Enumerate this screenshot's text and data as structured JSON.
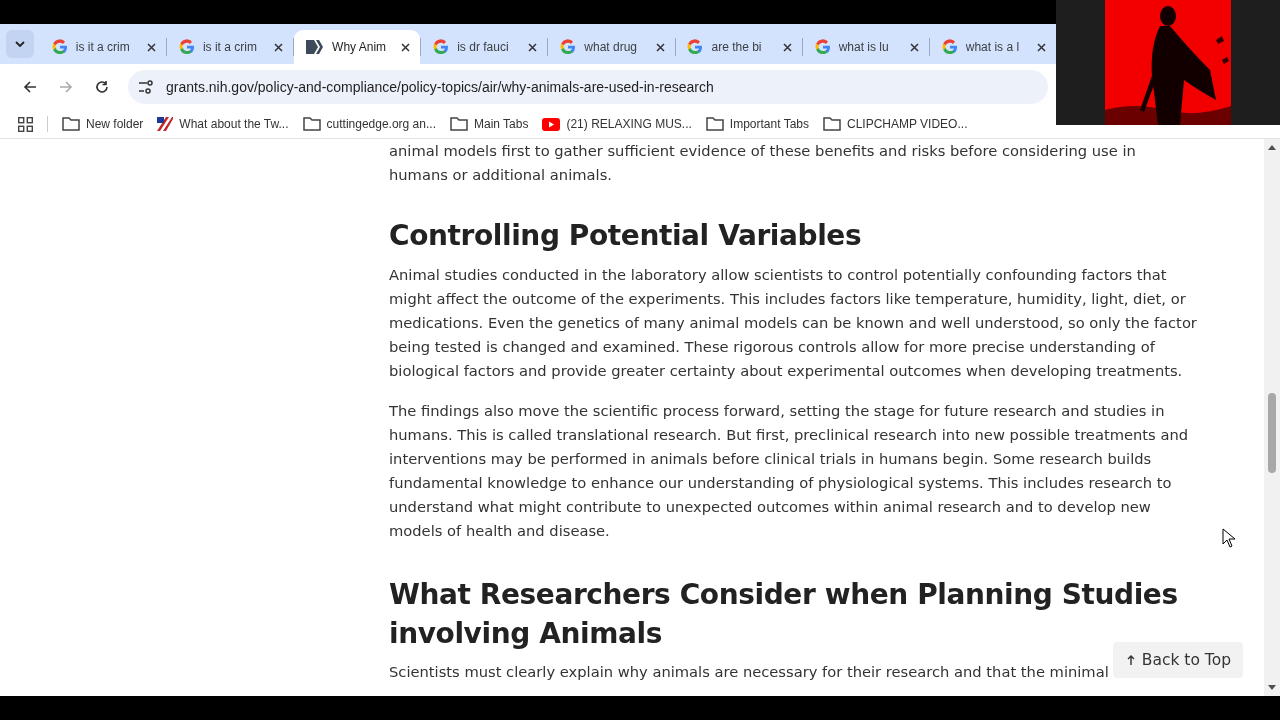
{
  "tabs": [
    {
      "title": "is it a crim",
      "kind": "search",
      "selected": false
    },
    {
      "title": "is it a crim",
      "kind": "search",
      "selected": false
    },
    {
      "title": "Why Anim",
      "kind": "site",
      "selected": true
    },
    {
      "title": "is dr fauci",
      "kind": "search",
      "selected": false
    },
    {
      "title": "what drug",
      "kind": "search",
      "selected": false
    },
    {
      "title": "are the bi",
      "kind": "search",
      "selected": false
    },
    {
      "title": "what is lu",
      "kind": "search",
      "selected": false
    },
    {
      "title": "what is a l",
      "kind": "search",
      "selected": false
    }
  ],
  "address": {
    "url": "grants.nih.gov/policy-and-compliance/policy-topics/air/why-animals-are-used-in-research"
  },
  "bookmarks": [
    {
      "label": "New folder",
      "kind": "folder"
    },
    {
      "label": "What about the Tw...",
      "kind": "page"
    },
    {
      "label": "cuttingedge.org an...",
      "kind": "folder"
    },
    {
      "label": "Main Tabs",
      "kind": "folder"
    },
    {
      "label": "(21) RELAXING MUS...",
      "kind": "video"
    },
    {
      "label": "Important Tabs",
      "kind": "folder"
    },
    {
      "label": "CLIPCHAMP VIDEO...",
      "kind": "folder"
    }
  ],
  "article": [
    {
      "kind": "paragraph",
      "lines": [
        "animal models first to gather sufficient evidence of these benefits and risks before considering use in",
        "humans or additional animals."
      ]
    },
    {
      "kind": "heading",
      "text": "Controlling Potential Variables"
    },
    {
      "kind": "paragraph",
      "lines": [
        "Animal studies conducted in the laboratory allow scientists to control potentially confounding factors that",
        "might affect the outcome of the experiments. This includes factors like temperature, humidity, light, diet, or",
        "medications. Even the genetics of many animal models can be known and well understood, so only the factor",
        "being tested is changed and examined. These rigorous controls allow for more precise understanding of",
        "biological factors and provide greater certainty about experimental outcomes when developing treatments."
      ]
    },
    {
      "kind": "paragraph",
      "lines": [
        "The findings also move the scientific process forward, setting the stage for future research and studies in",
        "humans. This is called translational research. But first, preclinical research into new possible treatments and",
        "interventions may be performed in animals before clinical trials in humans begin. Some research builds",
        "fundamental knowledge to enhance our understanding of physiological systems. This includes research to",
        "understand what might contribute to unexpected outcomes within animal research and to develop new",
        "models of health and disease."
      ]
    },
    {
      "kind": "heading",
      "text": "What Researchers Consider when Planning Studies involving Animals"
    },
    {
      "kind": "paragraph",
      "lines": [
        "Scientists must clearly explain why animals are necessary for their research and that the minimal"
      ]
    }
  ],
  "back_to_top": {
    "label": "Back to Top"
  }
}
